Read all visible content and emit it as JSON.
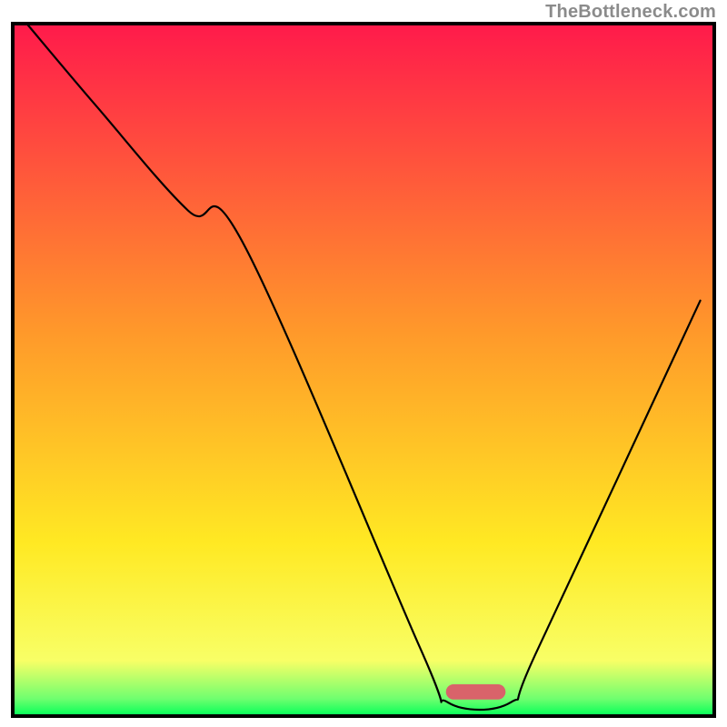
{
  "watermark": "TheBottleneck.com",
  "chart_data": {
    "type": "line",
    "title": "",
    "xlabel": "",
    "ylabel": "",
    "xlim": [
      0,
      100
    ],
    "ylim": [
      0,
      100
    ],
    "grid": false,
    "frame_color": "#000000",
    "frame_width": 4,
    "background": {
      "type": "vertical-gradient",
      "stops": [
        {
          "offset": 0.0,
          "color": "#ff1a4b"
        },
        {
          "offset": 0.45,
          "color": "#ff9a2a"
        },
        {
          "offset": 0.75,
          "color": "#ffe923"
        },
        {
          "offset": 0.92,
          "color": "#f8ff66"
        },
        {
          "offset": 0.975,
          "color": "#6fff6f"
        },
        {
          "offset": 1.0,
          "color": "#00ff58"
        }
      ]
    },
    "series": [
      {
        "name": "bottleneck-curve",
        "color": "#000000",
        "width": 2.2,
        "x": [
          2,
          12,
          25,
          33,
          58,
          62,
          71,
          75,
          98
        ],
        "y": [
          100,
          88,
          73,
          68,
          10,
          2,
          2,
          10,
          60
        ]
      }
    ],
    "marker": {
      "name": "pill-marker",
      "shape": "pill",
      "cx": 66,
      "cy": 3.5,
      "w": 8.5,
      "h": 2.2,
      "color": "#d9636a"
    }
  }
}
